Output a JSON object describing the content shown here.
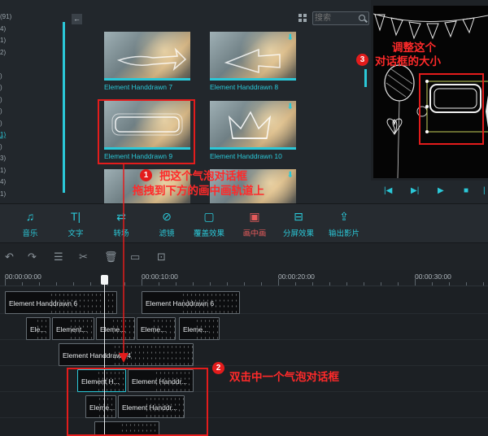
{
  "side_list": [
    "(91)",
    "4)",
    "1)",
    "2)",
    "",
    ")",
    ")",
    ")",
    ")",
    ")",
    "1)",
    ")",
    "3)",
    "1)",
    "4)",
    "1)"
  ],
  "side_list_active_index": 10,
  "collapse_label": "←",
  "search": {
    "placeholder": "搜索"
  },
  "thumbnails": [
    {
      "label": "Element Handdrawn 7",
      "download": false
    },
    {
      "label": "Element Handdrawn 8",
      "download": true
    },
    {
      "label": "Element Handdrawn 9",
      "download": false
    },
    {
      "label": "Element Handdrawn 10",
      "download": true
    },
    {
      "label": "",
      "download": true
    }
  ],
  "preview_controls": [
    "|◀",
    "▶|",
    "▶",
    "■",
    "|"
  ],
  "toolbar": [
    {
      "label": "音乐",
      "icon": "music-note-icon",
      "glyph": "♫"
    },
    {
      "label": "文字",
      "icon": "text-icon",
      "glyph": "T|"
    },
    {
      "label": "转场",
      "icon": "transition-icon",
      "glyph": "⇄"
    },
    {
      "label": "滤镜",
      "icon": "filter-icon",
      "glyph": "⊘"
    },
    {
      "label": "覆盖效果",
      "icon": "overlay-icon",
      "glyph": "▢"
    },
    {
      "label": "画中画",
      "icon": "picture-in-picture-icon",
      "glyph": "▣"
    },
    {
      "label": "分屏效果",
      "icon": "split-screen-icon",
      "glyph": "⊟"
    },
    {
      "label": "输出影片",
      "icon": "export-icon",
      "glyph": "⇪"
    }
  ],
  "toolbar_active_index": 5,
  "editbar_icons": [
    {
      "name": "undo-icon",
      "glyph": "↶"
    },
    {
      "name": "redo-icon",
      "glyph": "↷"
    },
    {
      "name": "adjust-icon",
      "glyph": "☰"
    },
    {
      "name": "cut-icon",
      "glyph": "✂"
    },
    {
      "name": "delete-icon",
      "glyph": "🗑"
    },
    {
      "name": "crop-icon",
      "glyph": "▭"
    },
    {
      "name": "snapshot-icon",
      "glyph": "⊡"
    }
  ],
  "ruler": [
    "00:00:00:00",
    "00:00:10:00",
    "00:00:20:00",
    "00:00:30:00"
  ],
  "tracks": [
    [
      {
        "label": "Element Handdrawn 6"
      },
      {
        "label": "Element Handdrawn 6"
      }
    ],
    [
      {
        "label": "Ele..."
      },
      {
        "label": "Element..."
      },
      {
        "label": "Eleme..."
      },
      {
        "label": "Eleme..."
      },
      {
        "label": "Eleme..."
      }
    ],
    [
      {
        "label": "Element Handdrawn 4"
      }
    ],
    [
      {
        "label": "Element H..."
      },
      {
        "label": "Element Handdr..."
      }
    ],
    [
      {
        "label": "Eleme..."
      },
      {
        "label": "Element Handdr..."
      }
    ],
    [
      {
        "label": ""
      }
    ]
  ],
  "annotations": {
    "step1_num": "1",
    "step1_line1": "把这个气泡对话框",
    "step1_line2": "拖拽到下方的画中画轨道上",
    "step2_num": "2",
    "step2_text": "双击中一个气泡对话框",
    "step3_num": "3",
    "step3_line1": "调整这个",
    "step3_line2": "对话框的大小"
  },
  "colors": {
    "accent": "#2bc8d8",
    "annotation": "#e31c1c",
    "active_tool": "#e45b5b"
  }
}
